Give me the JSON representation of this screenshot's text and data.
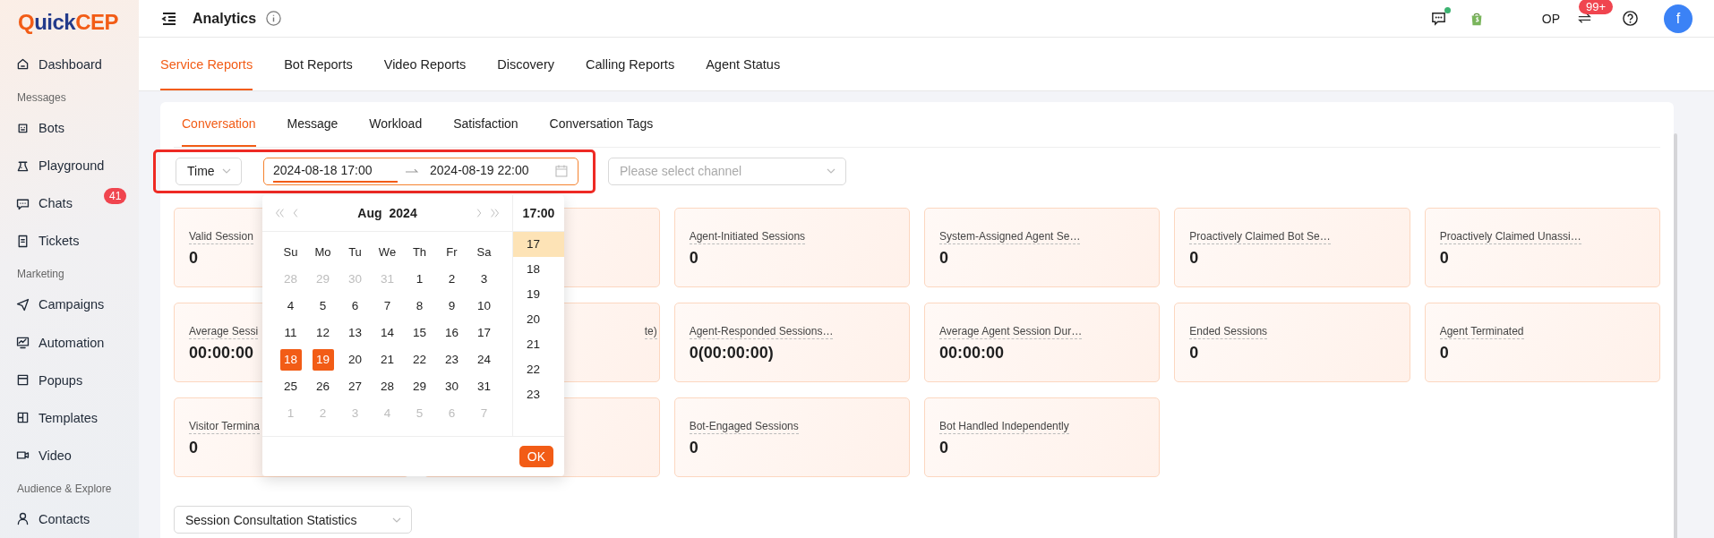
{
  "sidebar": {
    "logo": [
      "Q",
      "uick",
      "CEP"
    ],
    "sections": [
      {
        "items": [
          {
            "label": "Dashboard"
          }
        ]
      },
      {
        "heading": "Messages",
        "items": [
          {
            "label": "Bots"
          },
          {
            "label": "Playground"
          },
          {
            "label": "Chats",
            "badge": "41"
          },
          {
            "label": "Tickets"
          }
        ]
      },
      {
        "heading": "Marketing",
        "items": [
          {
            "label": "Campaigns"
          },
          {
            "label": "Automation"
          },
          {
            "label": "Popups"
          },
          {
            "label": "Templates"
          },
          {
            "label": "Video"
          }
        ]
      },
      {
        "heading": "Audience & Explore",
        "items": [
          {
            "label": "Contacts"
          }
        ]
      }
    ]
  },
  "header": {
    "title": "Analytics",
    "shop_name": "OP",
    "notification_count": "99+",
    "chat_online": true,
    "avatar_letter": "f"
  },
  "report_tabs": [
    {
      "label": "Service Reports",
      "selected": true
    },
    {
      "label": "Bot Reports",
      "selected": false
    },
    {
      "label": "Video Reports",
      "selected": false
    },
    {
      "label": "Discovery",
      "selected": false
    },
    {
      "label": "Calling Reports",
      "selected": false
    },
    {
      "label": "Agent Status",
      "selected": false
    }
  ],
  "sub_tabs": [
    {
      "label": "Conversation",
      "selected": true
    },
    {
      "label": "Message",
      "selected": false
    },
    {
      "label": "Workload",
      "selected": false
    },
    {
      "label": "Satisfaction",
      "selected": false
    },
    {
      "label": "Conversation Tags",
      "selected": false
    }
  ],
  "filters": {
    "highlighted": true,
    "type_select": "Time",
    "start": "2024-08-18 17:00",
    "end": "2024-08-19 22:00",
    "start_active": true,
    "channel_placeholder": "Please select channel"
  },
  "date_picker": {
    "month": "Aug",
    "year": "2024",
    "weekdays": [
      "Su",
      "Mo",
      "Tu",
      "We",
      "Th",
      "Fr",
      "Sa"
    ],
    "days": [
      {
        "d": "28",
        "muted": true,
        "selected": false
      },
      {
        "d": "29",
        "muted": true,
        "selected": false
      },
      {
        "d": "30",
        "muted": true,
        "selected": false
      },
      {
        "d": "31",
        "muted": true,
        "selected": false
      },
      {
        "d": "1",
        "muted": false,
        "selected": false
      },
      {
        "d": "2",
        "muted": false,
        "selected": false
      },
      {
        "d": "3",
        "muted": false,
        "selected": false
      },
      {
        "d": "4",
        "muted": false,
        "selected": false
      },
      {
        "d": "5",
        "muted": false,
        "selected": false
      },
      {
        "d": "6",
        "muted": false,
        "selected": false
      },
      {
        "d": "7",
        "muted": false,
        "selected": false
      },
      {
        "d": "8",
        "muted": false,
        "selected": false
      },
      {
        "d": "9",
        "muted": false,
        "selected": false
      },
      {
        "d": "10",
        "muted": false,
        "selected": false
      },
      {
        "d": "11",
        "muted": false,
        "selected": false
      },
      {
        "d": "12",
        "muted": false,
        "selected": false
      },
      {
        "d": "13",
        "muted": false,
        "selected": false
      },
      {
        "d": "14",
        "muted": false,
        "selected": false
      },
      {
        "d": "15",
        "muted": false,
        "selected": false
      },
      {
        "d": "16",
        "muted": false,
        "selected": false
      },
      {
        "d": "17",
        "muted": false,
        "selected": false
      },
      {
        "d": "18",
        "muted": false,
        "selected": true
      },
      {
        "d": "19",
        "muted": false,
        "selected": true
      },
      {
        "d": "20",
        "muted": false,
        "selected": false
      },
      {
        "d": "21",
        "muted": false,
        "selected": false
      },
      {
        "d": "22",
        "muted": false,
        "selected": false
      },
      {
        "d": "23",
        "muted": false,
        "selected": false
      },
      {
        "d": "24",
        "muted": false,
        "selected": false
      },
      {
        "d": "25",
        "muted": false,
        "selected": false
      },
      {
        "d": "26",
        "muted": false,
        "selected": false
      },
      {
        "d": "27",
        "muted": false,
        "selected": false
      },
      {
        "d": "28",
        "muted": false,
        "selected": false
      },
      {
        "d": "29",
        "muted": false,
        "selected": false
      },
      {
        "d": "30",
        "muted": false,
        "selected": false
      },
      {
        "d": "31",
        "muted": false,
        "selected": false
      },
      {
        "d": "1",
        "muted": true,
        "selected": false
      },
      {
        "d": "2",
        "muted": true,
        "selected": false
      },
      {
        "d": "3",
        "muted": true,
        "selected": false
      },
      {
        "d": "4",
        "muted": true,
        "selected": false
      },
      {
        "d": "5",
        "muted": true,
        "selected": false
      },
      {
        "d": "6",
        "muted": true,
        "selected": false
      },
      {
        "d": "7",
        "muted": true,
        "selected": false
      }
    ],
    "time_header": "17:00",
    "hours": [
      {
        "label": "17",
        "selected": true
      },
      {
        "label": "18",
        "selected": false
      },
      {
        "label": "19",
        "selected": false
      },
      {
        "label": "20",
        "selected": false
      },
      {
        "label": "21",
        "selected": false
      },
      {
        "label": "22",
        "selected": false
      },
      {
        "label": "23",
        "selected": false
      }
    ],
    "ok": "OK"
  },
  "cards": [
    {
      "kind": "metric",
      "label": "Valid Session",
      "value": "0"
    },
    {
      "kind": "covered"
    },
    {
      "kind": "metric",
      "label": "Agent-Initiated Sessions",
      "value": "0"
    },
    {
      "kind": "metric",
      "label": "System-Assigned Agent Se…",
      "value": "0"
    },
    {
      "kind": "metric",
      "label": "Proactively Claimed Bot Se…",
      "value": "0"
    },
    {
      "kind": "metric",
      "label": "Proactively Claimed Unassi…",
      "value": "0"
    },
    {
      "kind": "metric",
      "label": "Average Sessi",
      "value": "00:00:00"
    },
    {
      "kind": "covered",
      "label": "te)"
    },
    {
      "kind": "metric",
      "label": "Agent-Responded Sessions…",
      "value": "0(00:00:00)"
    },
    {
      "kind": "metric",
      "label": "Average Agent Session Dur…",
      "value": "00:00:00"
    },
    {
      "kind": "metric",
      "label": "Ended Sessions",
      "value": "0"
    },
    {
      "kind": "metric",
      "label": "Agent Terminated",
      "value": "0"
    },
    {
      "kind": "metric",
      "label": "Visitor Termina",
      "value": "0"
    },
    {
      "kind": "covered"
    },
    {
      "kind": "metric",
      "label": "Bot-Engaged Sessions",
      "value": "0"
    },
    {
      "kind": "metric",
      "label": "Bot Handled Independently",
      "value": "0"
    }
  ],
  "statistics_select": "Session Consultation Statistics"
}
